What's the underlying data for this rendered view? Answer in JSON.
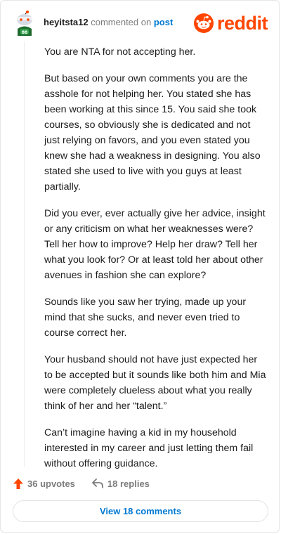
{
  "header": {
    "username": "heyitsta12",
    "commented_on": "commented on",
    "post_link": "post",
    "logo_text": "reddit"
  },
  "comment": {
    "paragraphs": [
      "You are NTA for not accepting her.",
      "But based on your own comments you are the asshole for not helping her. You stated she has been working at this since 15. You said she took courses, so obviously she is dedicated and not just relying on favors, and you even stated you knew she had a weakness in designing. You also stated she used to live with you guys at least partially.",
      "Did you ever, ever actually give her advice, insight or any criticism on what her weaknesses were? Tell her how to improve? Help her draw? Tell her what you look for? Or at least told her about other avenues in fashion she can explore?",
      "Sounds like you saw her trying, made up your mind that she sucks, and never even tried to course correct her.",
      "Your husband should not have just expected her to be accepted but it sounds like both him and Mia were completely clueless about what you really think of her and her “talent.”",
      "Can’t imagine having a kid in my household interested in my career and just letting them fail without offering guidance."
    ]
  },
  "actions": {
    "upvotes": "36 upvotes",
    "replies": "18 replies",
    "upvote_icon": "upvote-arrow-icon",
    "reply_icon": "reply-arrow-icon"
  },
  "footer": {
    "view_comments": "View 18 comments"
  },
  "colors": {
    "brand": "#ff4500",
    "link": "#0079d3",
    "text": "#1c1c1c",
    "muted": "#7c7c7c"
  }
}
